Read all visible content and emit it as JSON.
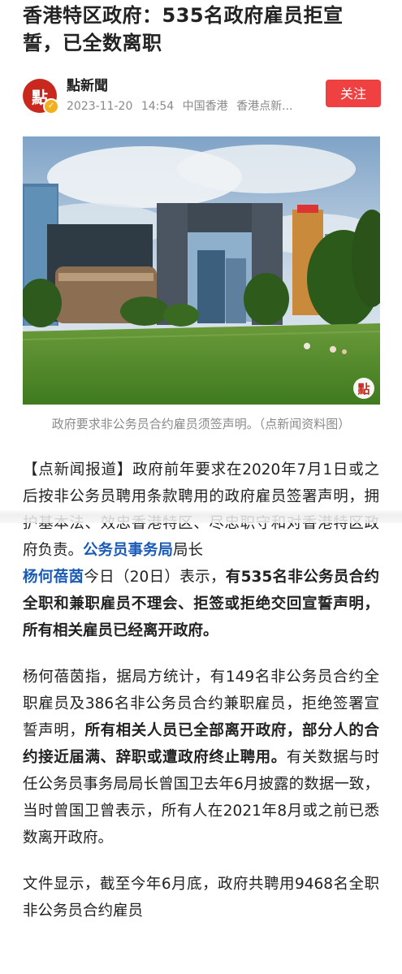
{
  "headline": "香港特区政府：535名政府雇员拒宣誓，已全数离职",
  "author": {
    "avatar_text": "點",
    "name": "點新聞",
    "date": "2023-11-20",
    "time": "14:54",
    "location": "中国香港",
    "source": "香港点新...",
    "follow_label": "关注"
  },
  "photo": {
    "watermark": "點"
  },
  "caption": "政府要求非公务员合约雇员须签声明。（点新闻资料图）",
  "paragraph1": {
    "part1": "【点新闻报道】政府前年要求在2020年7月1日或之后按非公务员聘用条款聘用的政府雇员签署声明，拥护基本法、效忠香港特区、尽忠职守和对香港特区政府负责。",
    "link": "公务员事务局",
    "part2": "局长",
    "link2": "杨何蓓茵",
    "part3": "今日（20日）表示，",
    "bold": "有535名非公务员合约全职和兼职雇员不理会、拒签或拒绝交回宣誓声明，所有相关雇员已经离开政府。"
  },
  "paragraph2": {
    "part1": "杨何蓓茵指，据局方统计，有149名非公务员合约全职雇员及386名非公务员合约兼职雇员，拒绝签署宣誓声明，",
    "bold": "所有相关人员已全部离开政府，部分人的合约接近届满、辞职或遭政府终止聘用。",
    "part2": "有关数据与时任公务员事务局局长曾国卫去年6月披露的数据一致，当时曾国卫曾表示，所有人在2021年8月或之前已悉数离开政府。"
  },
  "paragraph3": {
    "text": "文件显示，截至今年6月底，政府共聘用9468名全职非公务员合约雇员"
  },
  "colors": {
    "follow": "#f04142",
    "link": "#1a5bb8",
    "meta": "#8a8a8a",
    "avatar": "#c8281e"
  }
}
